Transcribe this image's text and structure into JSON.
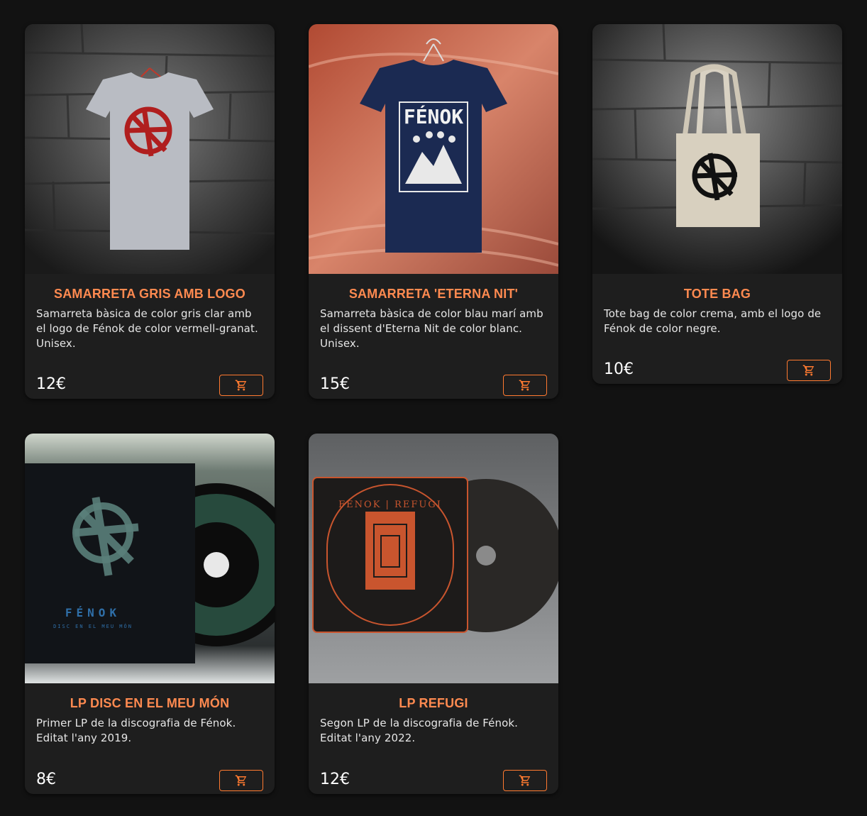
{
  "accent": "#ff8a50",
  "products": [
    {
      "title": "SAMARRETA GRIS AMB LOGO",
      "description": "Samarreta bàsica de color gris clar amb el logo de Fénok de color vermell-granat. Unisex.",
      "price": "12€",
      "cart_icon": "cart-icon"
    },
    {
      "title": "SAMARRETA 'ETERNA NIT'",
      "description": "Samarreta bàsica de color blau marí amb el dissent d'Eterna Nit de color blanc. Unisex.",
      "price": "15€",
      "cart_icon": "cart-icon",
      "image_text": "FÉNOK"
    },
    {
      "title": "TOTE BAG",
      "description": "Tote bag de color crema, amb el logo de Fénok de color negre.",
      "price": "10€",
      "cart_icon": "cart-icon"
    },
    {
      "title": "LP DISC EN EL MEU MÓN",
      "description": "Primer LP de la discografia de Fénok. Editat l'any 2019.",
      "price": "8€",
      "cart_icon": "cart-icon",
      "image_text": "FÉNOK",
      "image_subtext": "DISC EN EL MEU MÓN"
    },
    {
      "title": "LP REFUGI",
      "description": "Segon LP de la discografia de Fénok. Editat l'any 2022.",
      "price": "12€",
      "cart_icon": "cart-icon",
      "image_text": "FÉNOK | REFUGI"
    }
  ]
}
